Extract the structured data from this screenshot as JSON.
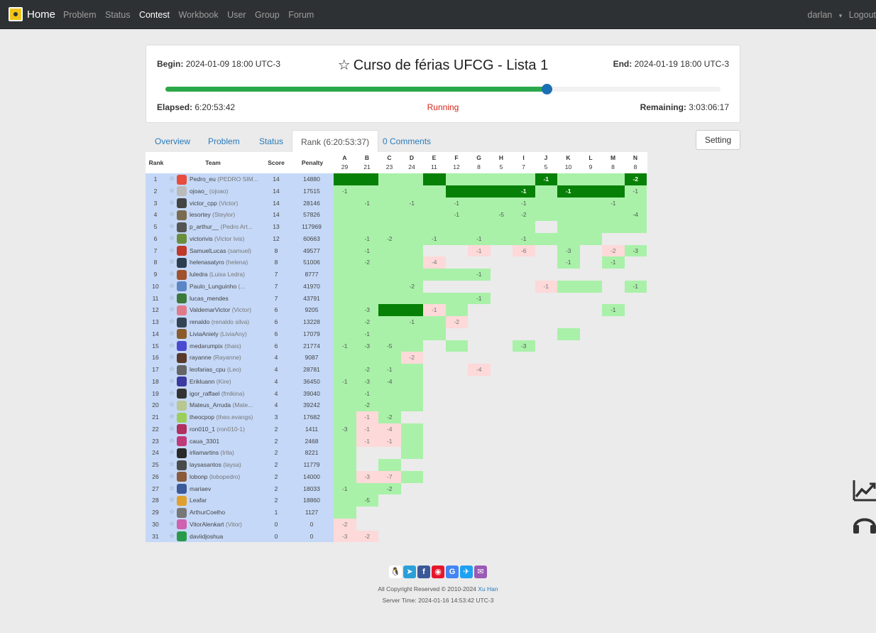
{
  "nav": {
    "brand": "Home",
    "links": [
      "Problem",
      "Status",
      "Contest",
      "Workbook",
      "User",
      "Group",
      "Forum"
    ],
    "active": "Contest",
    "user": "darlan",
    "caret": "▾",
    "logout": "Logout"
  },
  "contest": {
    "begin_label": "Begin:",
    "begin": "2024-01-09 18:00 UTC-3",
    "end_label": "End:",
    "end": "2024-01-19 18:00 UTC-3",
    "title": "Curso de férias UFCG - Lista 1",
    "elapsed_label": "Elapsed:",
    "elapsed": "6:20:53:42",
    "status": "Running",
    "remaining_label": "Remaining:",
    "remaining": "3:03:06:17",
    "progress": 0.687
  },
  "tabs": [
    "Overview",
    "Problem",
    "Status",
    "Rank (6:20:53:37)",
    "0 Comments"
  ],
  "setting": "Setting",
  "table": {
    "headers": {
      "rank": "Rank",
      "team": "Team",
      "score": "Score",
      "penalty": "Penalty"
    },
    "problems": [
      {
        "id": "A",
        "ac": "29"
      },
      {
        "id": "B",
        "ac": "21"
      },
      {
        "id": "C",
        "ac": "23"
      },
      {
        "id": "D",
        "ac": "24"
      },
      {
        "id": "E",
        "ac": "11"
      },
      {
        "id": "F",
        "ac": "12"
      },
      {
        "id": "G",
        "ac": "8"
      },
      {
        "id": "H",
        "ac": "5"
      },
      {
        "id": "I",
        "ac": "7"
      },
      {
        "id": "J",
        "ac": "5"
      },
      {
        "id": "K",
        "ac": "10"
      },
      {
        "id": "L",
        "ac": "9"
      },
      {
        "id": "M",
        "ac": "8"
      },
      {
        "id": "N",
        "ac": "8"
      }
    ],
    "rows": [
      {
        "rank": "1",
        "name": "Pedro_eu",
        "nick": "(PEDRO SIM...",
        "score": "14",
        "penalty": "14880",
        "av": "#e74c3c",
        "cells": [
          "FB",
          "FB",
          "A",
          "A",
          "FB",
          "A",
          "A",
          "A",
          "A",
          "FB:-1",
          "A",
          "A",
          "A",
          "FB:-2"
        ]
      },
      {
        "rank": "2",
        "name": "ojoao_",
        "nick": "(ojoao)",
        "score": "14",
        "penalty": "17515",
        "av": "#bbbbbb",
        "cells": [
          "A:-1",
          "A",
          "A",
          "A",
          "A",
          "FB",
          "FB",
          "FB",
          "FB:-1",
          "A",
          "FB:-1",
          "FB",
          "FB",
          "A:-1"
        ]
      },
      {
        "rank": "3",
        "name": "victor_cpp",
        "nick": "(Victor)",
        "score": "14",
        "penalty": "28146",
        "av": "#444444",
        "cells": [
          "A",
          "A:-1",
          "A",
          "A:-1",
          "A",
          "A:-1",
          "A",
          "A",
          "A:-1",
          "A",
          "A",
          "A",
          "A:-1",
          "A"
        ]
      },
      {
        "rank": "4",
        "name": "lesortey",
        "nick": "(Steylor)",
        "score": "14",
        "penalty": "57826",
        "av": "#7a6a4f",
        "cells": [
          "A",
          "A",
          "A",
          "A",
          "A",
          "A:-1",
          "A",
          "A:-5",
          "A:-2",
          "A",
          "A",
          "A",
          "A",
          "A:-4"
        ]
      },
      {
        "rank": "5",
        "name": "p_arthur__",
        "nick": "(Pedro Art...",
        "score": "13",
        "penalty": "117969",
        "av": "#555555",
        "cells": [
          "A",
          "A",
          "A",
          "A",
          "A",
          "A",
          "A",
          "A",
          "A",
          "",
          "A",
          "A",
          "A",
          "A"
        ]
      },
      {
        "rank": "6",
        "name": "victorivis",
        "nick": "(Victor Ivis)",
        "score": "12",
        "penalty": "60663",
        "av": "#6a8f3c",
        "cells": [
          "A",
          "A:-1",
          "A:-2",
          "A",
          "A:-1",
          "A",
          "A:-1",
          "A",
          "A:-1",
          "A",
          "A",
          "A",
          "",
          ""
        ]
      },
      {
        "rank": "7",
        "name": "SamuelLucas",
        "nick": "(samuel)",
        "score": "8",
        "penalty": "49577",
        "av": "#c0392b",
        "cells": [
          "A",
          "A:-1",
          "A",
          "A",
          "",
          "",
          "F:-1",
          "",
          "F:-6",
          "",
          "A:-3",
          "",
          "F:-2",
          "A:-3"
        ]
      },
      {
        "rank": "8",
        "name": "helenasatyro",
        "nick": "(helena)",
        "score": "8",
        "penalty": "51006",
        "av": "#2c3e50",
        "cells": [
          "A",
          "A:-2",
          "A",
          "A",
          "F:-4",
          "",
          "",
          "",
          "",
          "",
          "A:-1",
          "",
          "A:-1",
          ""
        ]
      },
      {
        "rank": "9",
        "name": "luledra",
        "nick": "(Luisa Ledra)",
        "score": "7",
        "penalty": "8777",
        "av": "#a0522d",
        "cells": [
          "A",
          "A",
          "A",
          "A",
          "A",
          "A",
          "A:-1",
          "",
          "",
          "",
          "",
          "",
          "",
          ""
        ]
      },
      {
        "rank": "10",
        "name": "Paulo_Lunguinho",
        "nick": "(...",
        "score": "7",
        "penalty": "41970",
        "av": "#5b86c5",
        "cells": [
          "A",
          "A",
          "A",
          "A:-2",
          "",
          "",
          "",
          "",
          "",
          "F:-1",
          "A",
          "A",
          "",
          "A:-1"
        ]
      },
      {
        "rank": "11",
        "name": "lucas_mendes",
        "nick": "",
        "score": "7",
        "penalty": "43791",
        "av": "#3c7a3c",
        "cells": [
          "A",
          "A",
          "A",
          "A",
          "A",
          "A",
          "A:-1",
          "",
          "",
          "",
          "",
          "",
          "",
          ""
        ]
      },
      {
        "rank": "12",
        "name": "ValdemarVictor",
        "nick": "(Victor)",
        "score": "6",
        "penalty": "9205",
        "av": "#e07a8a",
        "cells": [
          "A",
          "A:-3",
          "FB",
          "FB",
          "F:-1",
          "A",
          "",
          "",
          "",
          "",
          "",
          "",
          "A:-1",
          ""
        ]
      },
      {
        "rank": "13",
        "name": "renaldo",
        "nick": "(renaldo silva)",
        "score": "6",
        "penalty": "13228",
        "av": "#334455",
        "cells": [
          "A",
          "A:-2",
          "A",
          "A:-1",
          "A",
          "F:-2",
          "",
          "",
          "",
          "",
          "",
          "",
          "",
          ""
        ]
      },
      {
        "rank": "14",
        "name": "LiviaAniely",
        "nick": "(LiviaAny)",
        "score": "6",
        "penalty": "17079",
        "av": "#8b5a2b",
        "cells": [
          "A",
          "A:-1",
          "A",
          "A",
          "A",
          "",
          "",
          "",
          "",
          "",
          "A",
          "",
          "",
          ""
        ]
      },
      {
        "rank": "15",
        "name": "medarumpix",
        "nick": "(thais)",
        "score": "6",
        "penalty": "21774",
        "av": "#4a4ad0",
        "cells": [
          "A:-1",
          "A:-3",
          "A:-5",
          "A",
          "",
          "A",
          "",
          "",
          "A:-3",
          "",
          "",
          "",
          "",
          ""
        ]
      },
      {
        "rank": "16",
        "name": "rayanne",
        "nick": "(Rayanne)",
        "score": "4",
        "penalty": "9087",
        "av": "#5a3a2a",
        "cells": [
          "A",
          "A",
          "A",
          "F:-2",
          "",
          "",
          "",
          "",
          "",
          "",
          "",
          "",
          "",
          ""
        ]
      },
      {
        "rank": "17",
        "name": "leofarias_cpu",
        "nick": "(Leo)",
        "score": "4",
        "penalty": "28781",
        "av": "#666666",
        "cells": [
          "A",
          "A:-2",
          "A:-1",
          "A",
          "",
          "",
          "F:-4",
          "",
          "",
          "",
          "",
          "",
          "",
          ""
        ]
      },
      {
        "rank": "18",
        "name": "Erikluann",
        "nick": "(Kire)",
        "score": "4",
        "penalty": "36450",
        "av": "#3a3aa0",
        "cells": [
          "A:-1",
          "A:-3",
          "A:-4",
          "A",
          "",
          "",
          "",
          "",
          "",
          "",
          "",
          "",
          "",
          ""
        ]
      },
      {
        "rank": "19",
        "name": "igor_raffael",
        "nick": "(fmlkina)",
        "score": "4",
        "penalty": "39040",
        "av": "#333333",
        "cells": [
          "A",
          "A:-1",
          "A",
          "A",
          "",
          "",
          "",
          "",
          "",
          "",
          "",
          "",
          "",
          ""
        ]
      },
      {
        "rank": "20",
        "name": "Mateus_Arruda",
        "nick": "(Mate...",
        "score": "4",
        "penalty": "39242",
        "av": "#b8c890",
        "cells": [
          "A",
          "A:-2",
          "A",
          "A",
          "",
          "",
          "",
          "",
          "",
          "",
          "",
          "",
          "",
          ""
        ]
      },
      {
        "rank": "21",
        "name": "theocpop",
        "nick": "(theo.evangs)",
        "score": "3",
        "penalty": "17682",
        "av": "#9ccf5a",
        "cells": [
          "A",
          "F:-1",
          "A:-2",
          "",
          "",
          "",
          "",
          "",
          "",
          "",
          "",
          "",
          "",
          ""
        ]
      },
      {
        "rank": "22",
        "name": "ron010_1",
        "nick": "(ron010-1)",
        "score": "2",
        "penalty": "1411",
        "av": "#b03060",
        "cells": [
          "A:-3",
          "F:-1",
          "F:-4",
          "A",
          "",
          "",
          "",
          "",
          "",
          "",
          "",
          "",
          "",
          ""
        ]
      },
      {
        "rank": "23",
        "name": "caua_3301",
        "nick": "",
        "score": "2",
        "penalty": "2468",
        "av": "#c03a7a",
        "cells": [
          "A",
          "F:-1",
          "F:-1",
          "A",
          "",
          "",
          "",
          "",
          "",
          "",
          "",
          "",
          "",
          ""
        ]
      },
      {
        "rank": "24",
        "name": "irllamartins",
        "nick": "(Irlla)",
        "score": "2",
        "penalty": "8221",
        "av": "#2a2a2a",
        "cells": [
          "A",
          "",
          "",
          "A",
          "",
          "",
          "",
          "",
          "",
          "",
          "",
          "",
          "",
          ""
        ]
      },
      {
        "rank": "25",
        "name": "laysasantos",
        "nick": "(laysa)",
        "score": "2",
        "penalty": "11779",
        "av": "#4a4a4a",
        "cells": [
          "A",
          "",
          "A",
          "",
          "",
          "",
          "",
          "",
          "",
          "",
          "",
          "",
          "",
          ""
        ]
      },
      {
        "rank": "26",
        "name": "lobonp",
        "nick": "(lobopedro)",
        "score": "2",
        "penalty": "14000",
        "av": "#8a5a3a",
        "cells": [
          "A",
          "F:-3",
          "F:-7",
          "A",
          "",
          "",
          "",
          "",
          "",
          "",
          "",
          "",
          "",
          ""
        ]
      },
      {
        "rank": "27",
        "name": "mariaev",
        "nick": "",
        "score": "2",
        "penalty": "18033",
        "av": "#3a5a9a",
        "cells": [
          "A:-1",
          "A",
          "A:-2",
          "",
          "",
          "",
          "",
          "",
          "",
          "",
          "",
          "",
          "",
          ""
        ]
      },
      {
        "rank": "28",
        "name": "Leafar",
        "nick": "",
        "score": "2",
        "penalty": "18860",
        "av": "#e0a030",
        "cells": [
          "A",
          "A:-5",
          "",
          "",
          "",
          "",
          "",
          "",
          "",
          "",
          "",
          "",
          "",
          ""
        ]
      },
      {
        "rank": "29",
        "name": "ArthurCoelho",
        "nick": "",
        "score": "1",
        "penalty": "1127",
        "av": "#777777",
        "cells": [
          "A",
          "",
          "",
          "",
          "",
          "",
          "",
          "",
          "",
          "",
          "",
          "",
          "",
          ""
        ]
      },
      {
        "rank": "30",
        "name": "VitorAlenkart",
        "nick": "(Vitor)",
        "score": "0",
        "penalty": "0",
        "av": "#d060b0",
        "cells": [
          "F:-2",
          "",
          "",
          "",
          "",
          "",
          "",
          "",
          "",
          "",
          "",
          "",
          "",
          ""
        ]
      },
      {
        "rank": "31",
        "name": "daviidjoshua",
        "nick": "",
        "score": "0",
        "penalty": "0",
        "av": "#2a9a4a",
        "cells": [
          "F:-3",
          "F:-2",
          "",
          "",
          "",
          "",
          "",
          "",
          "",
          "",
          "",
          "",
          "",
          ""
        ]
      }
    ]
  },
  "footer": {
    "copyright": "All Copyright Reserved © 2010-2024",
    "author": "Xu Han",
    "server_time": "Server Time: 2024-01-16 14:53:42 UTC-3",
    "share_icons": [
      {
        "name": "qq-icon",
        "color": "#ffffff",
        "glyph": "🐧"
      },
      {
        "name": "telegram-icon",
        "color": "#2ba0d8",
        "glyph": "➤"
      },
      {
        "name": "facebook-icon",
        "color": "#3b5998",
        "glyph": "f"
      },
      {
        "name": "weibo-icon",
        "color": "#e6162d",
        "glyph": "◉"
      },
      {
        "name": "google-icon",
        "color": "#4285f4",
        "glyph": "G"
      },
      {
        "name": "twitter-icon",
        "color": "#1da1f2",
        "glyph": "✈"
      },
      {
        "name": "email-icon",
        "color": "#9b59b6",
        "glyph": "✉"
      }
    ]
  }
}
